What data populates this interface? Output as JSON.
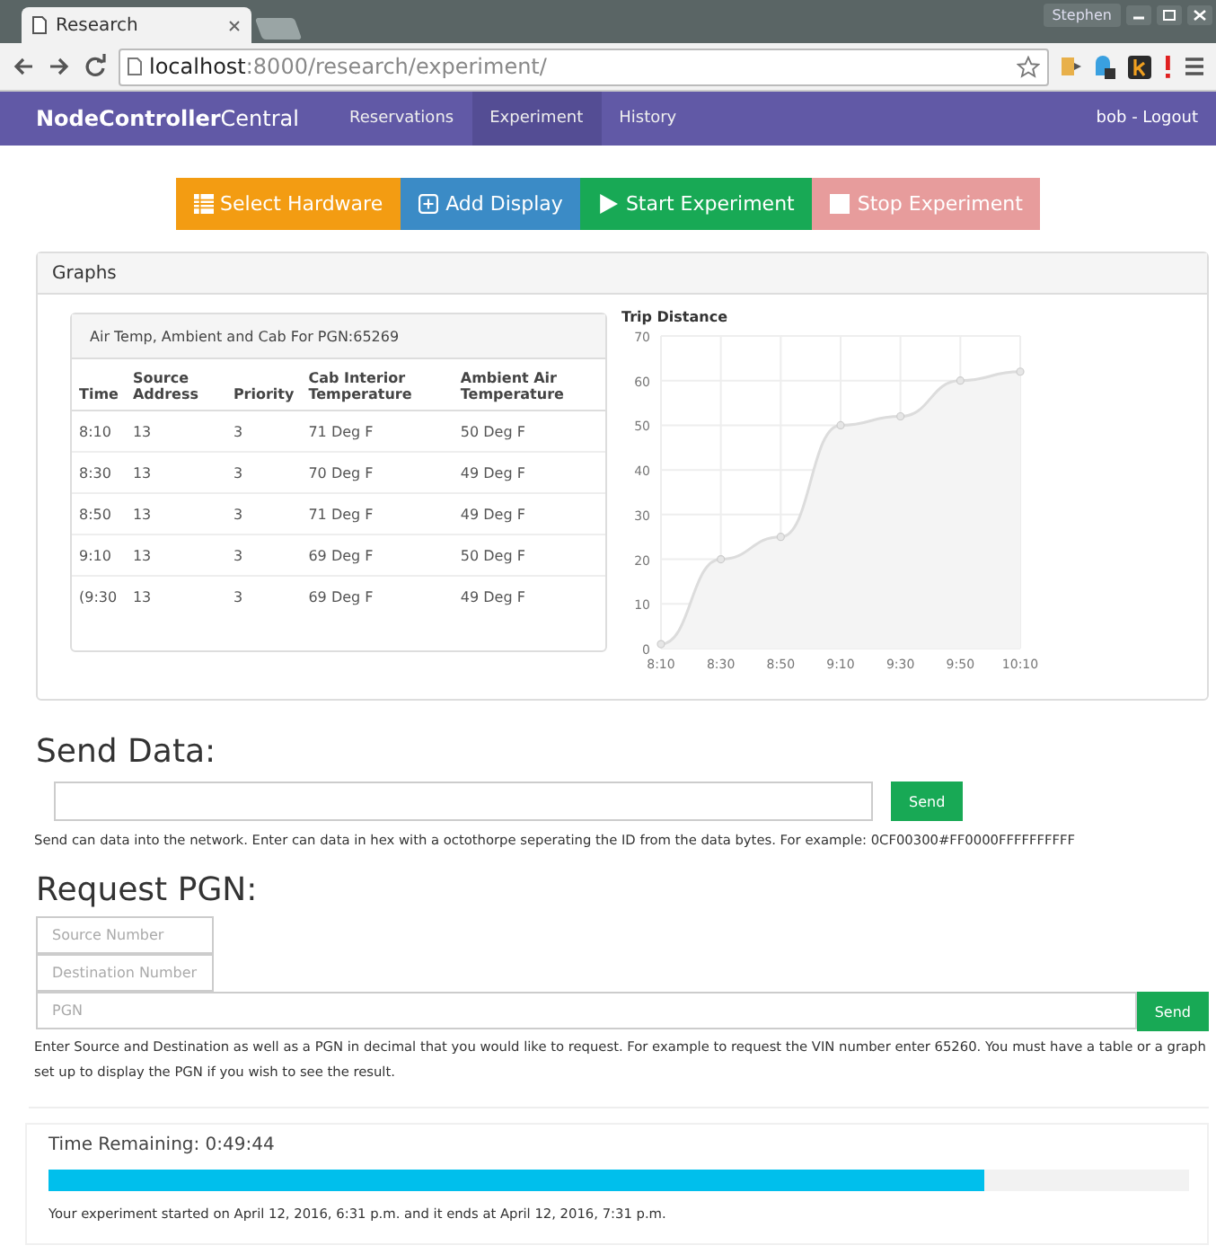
{
  "browser": {
    "tab_title": "Research",
    "profile": "Stephen",
    "url": {
      "host": "localhost",
      "path": ":8000/research/experiment/"
    }
  },
  "navbar": {
    "brand": {
      "bold": "NodeController",
      "light": "Central"
    },
    "items": [
      {
        "label": "Reservations",
        "selected": false
      },
      {
        "label": "Experiment",
        "selected": true
      },
      {
        "label": "History",
        "selected": false
      }
    ],
    "user_link": "bob - Logout"
  },
  "actions": [
    {
      "kind": "hardware",
      "label": "Select Hardware",
      "disabled": false
    },
    {
      "kind": "add",
      "label": "Add Display",
      "disabled": false
    },
    {
      "kind": "start",
      "label": "Start Experiment",
      "disabled": false
    },
    {
      "kind": "stop",
      "label": "Stop Experiment",
      "disabled": true
    }
  ],
  "graphs": {
    "title": "Graphs",
    "table": {
      "title": "Air Temp, Ambient and Cab For PGN:65269",
      "columns": [
        "Time",
        "Source Address",
        "Priority",
        "Cab Interior Temperature",
        "Ambient Air Temperature"
      ],
      "rows": [
        [
          "8:10",
          "13",
          "3",
          "71 Deg F",
          "50 Deg F"
        ],
        [
          "8:30",
          "13",
          "3",
          "70 Deg F",
          "49 Deg F"
        ],
        [
          "8:50",
          "13",
          "3",
          "71 Deg F",
          "49 Deg F"
        ],
        [
          "9:10",
          "13",
          "3",
          "69 Deg F",
          "50 Deg F"
        ],
        [
          "(9:30",
          "13",
          "3",
          "69 Deg F",
          "49 Deg F"
        ]
      ]
    },
    "chart": {
      "chart_data": {
        "type": "area",
        "title": "Trip Distance",
        "categories": [
          "8:10",
          "8:30",
          "8:50",
          "9:10",
          "9:30",
          "9:50",
          "10:10"
        ],
        "values": [
          1,
          20,
          25,
          50,
          52,
          60,
          62
        ],
        "grid": true,
        "ylim": [
          0,
          70
        ],
        "yticks": [
          0,
          10,
          20,
          30,
          40,
          50,
          60,
          70
        ]
      }
    }
  },
  "send_data": {
    "title": "Send Data:",
    "button": "Send",
    "help": "Send can data into the network. Enter can data in hex with a octothorpe seperating the ID from the data bytes. For example: 0CF00300#FF0000FFFFFFFFFF"
  },
  "request_pgn": {
    "title": "Request PGN:",
    "fields": [
      {
        "placeholder": "Source Number"
      },
      {
        "placeholder": "Destination Number"
      },
      {
        "placeholder": "PGN"
      }
    ],
    "button": "Send",
    "help": "Enter Source and Destination as well as a PGN in decimal that you would like to request. For example to request the VIN number enter 65260. You must have a table or a graph set up to display the PGN if you wish to see the result."
  },
  "timer": {
    "label": "Time Remaining: 0:49:44",
    "progress": {
      "level": 0.82
    },
    "note": "Your experiment started on April 12, 2016, 6:31 p.m. and it ends at April 12, 2016, 7:31 p.m."
  }
}
